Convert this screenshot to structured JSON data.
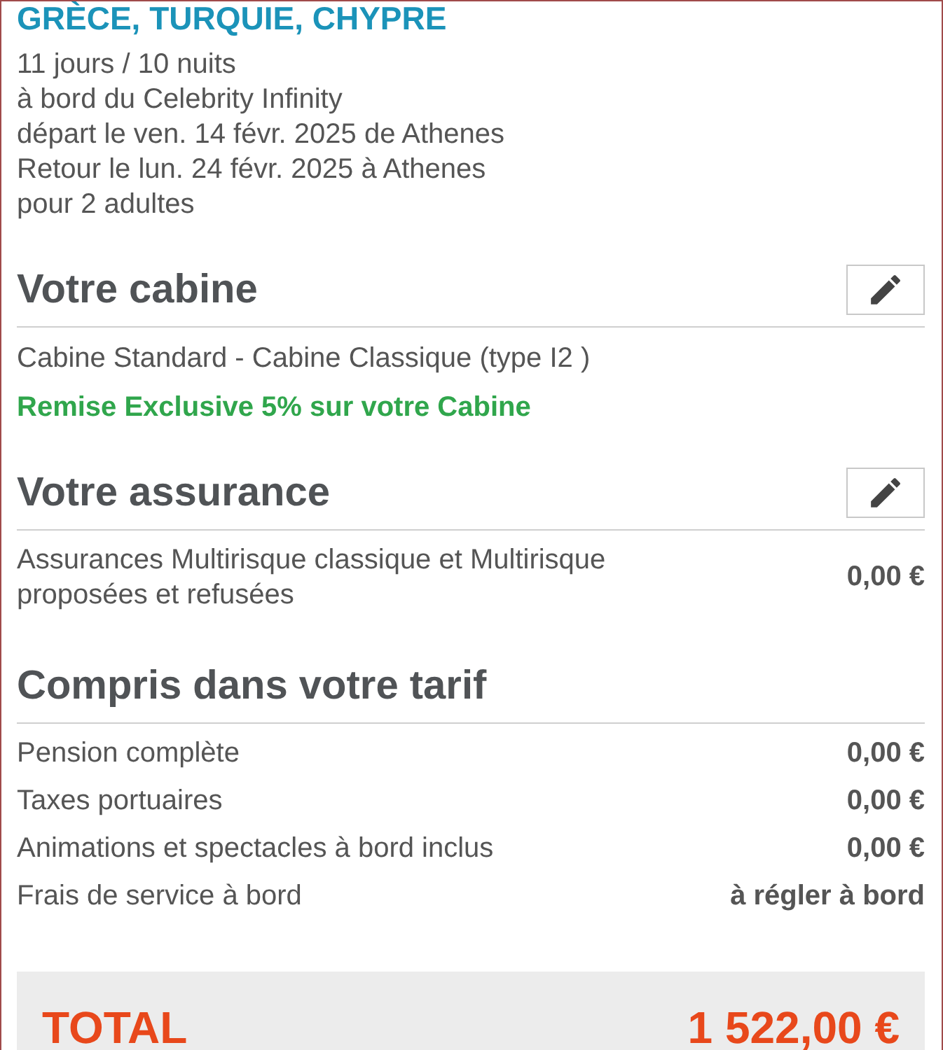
{
  "title": "GRÈCE, TURQUIE, CHYPRE",
  "details": [
    "11 jours / 10 nuits",
    "à bord du Celebrity Infinity",
    "départ le ven. 14 févr. 2025 de Athenes",
    "Retour le lun. 24 févr. 2025 à Athenes",
    "pour 2 adultes"
  ],
  "sections": [
    {
      "heading": "Votre cabine",
      "editable": true,
      "lines": [
        {
          "kind": "description",
          "text": "Cabine Standard - Cabine Classique (type I2 )"
        },
        {
          "kind": "promo",
          "text": "Remise Exclusive 5% sur votre Cabine"
        }
      ]
    },
    {
      "heading": "Votre assurance",
      "editable": true,
      "lines": [
        {
          "kind": "item",
          "label": "Assurances Multirisque classique et Multirisque proposées et refusées",
          "amount": "0,00 €"
        }
      ]
    },
    {
      "heading": "Compris dans votre tarif",
      "editable": false,
      "lines": [
        {
          "kind": "item",
          "label": "Pension complète",
          "amount": "0,00 €"
        },
        {
          "kind": "item",
          "label": "Taxes portuaires",
          "amount": "0,00 €"
        },
        {
          "kind": "item",
          "label": "Animations et spectacles à bord inclus",
          "amount": "0,00 €"
        },
        {
          "kind": "item",
          "label": "Frais de service à bord",
          "amount": "à régler à bord"
        }
      ]
    }
  ],
  "total": {
    "label": "TOTAL",
    "amount": "1 522,00 €"
  }
}
